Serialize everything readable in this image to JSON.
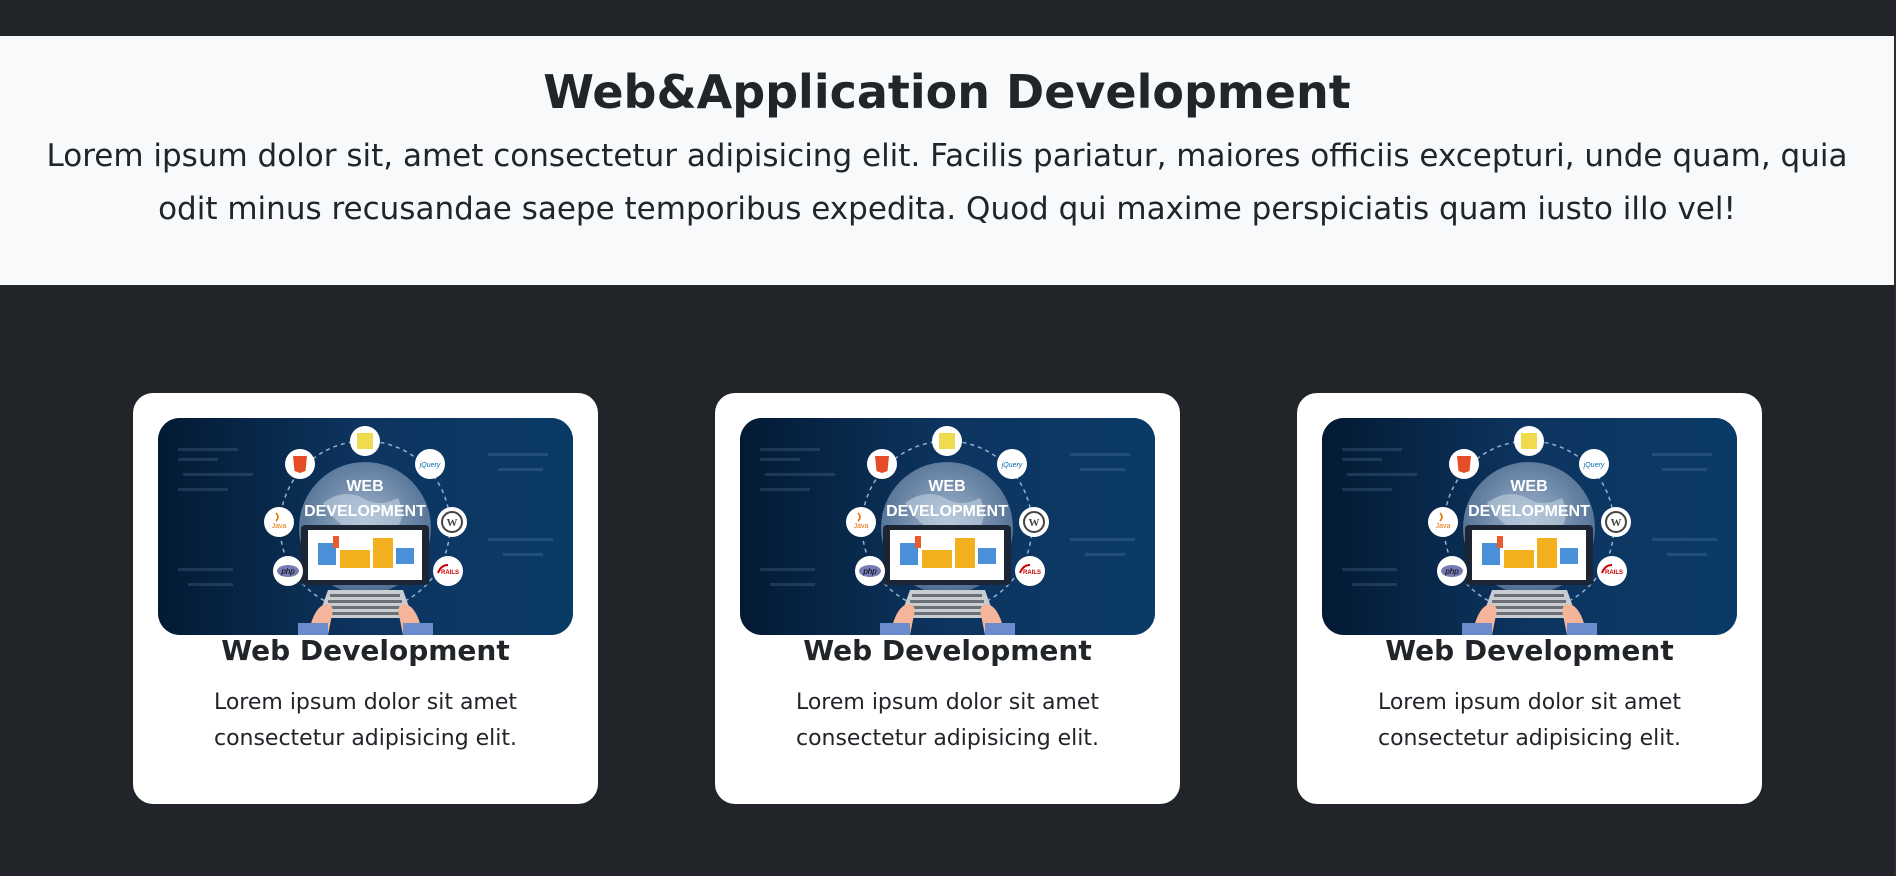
{
  "hero": {
    "title": "Web&Application Development",
    "text": "Lorem ipsum dolor sit, amet consectetur adipisicing elit. Facilis pariatur, maiores officiis excepturi, unde quam, quia odit minus recusandae saepe temporibus expedita. Quod qui maxime perspiciatis quam iusto illo vel!"
  },
  "cards": [
    {
      "title": "Web Development",
      "text": "Lorem ipsum dolor sit amet consectetur adipisicing elit.",
      "image": {
        "line1": "WEB",
        "line2": "DEVELOPMENT",
        "badges": [
          "HTML 5",
          "JS",
          "jQuery",
          "Java",
          "WordPress",
          "php",
          "RAILS"
        ]
      }
    },
    {
      "title": "Web Development",
      "text": "Lorem ipsum dolor sit amet consectetur adipisicing elit.",
      "image": {
        "line1": "WEB",
        "line2": "DEVELOPMENT",
        "badges": [
          "HTML 5",
          "JS",
          "jQuery",
          "Java",
          "WordPress",
          "php",
          "RAILS"
        ]
      }
    },
    {
      "title": "Web Development",
      "text": "Lorem ipsum dolor sit amet consectetur adipisicing elit.",
      "image": {
        "line1": "WEB",
        "line2": "DEVELOPMENT",
        "badges": [
          "HTML 5",
          "JS",
          "jQuery",
          "Java",
          "WordPress",
          "php",
          "RAILS"
        ]
      }
    }
  ],
  "colors": {
    "page_bg": "#212529",
    "hero_bg": "#f8f9fa",
    "card_bg": "#ffffff",
    "image_bg": "#0a2a4a"
  }
}
